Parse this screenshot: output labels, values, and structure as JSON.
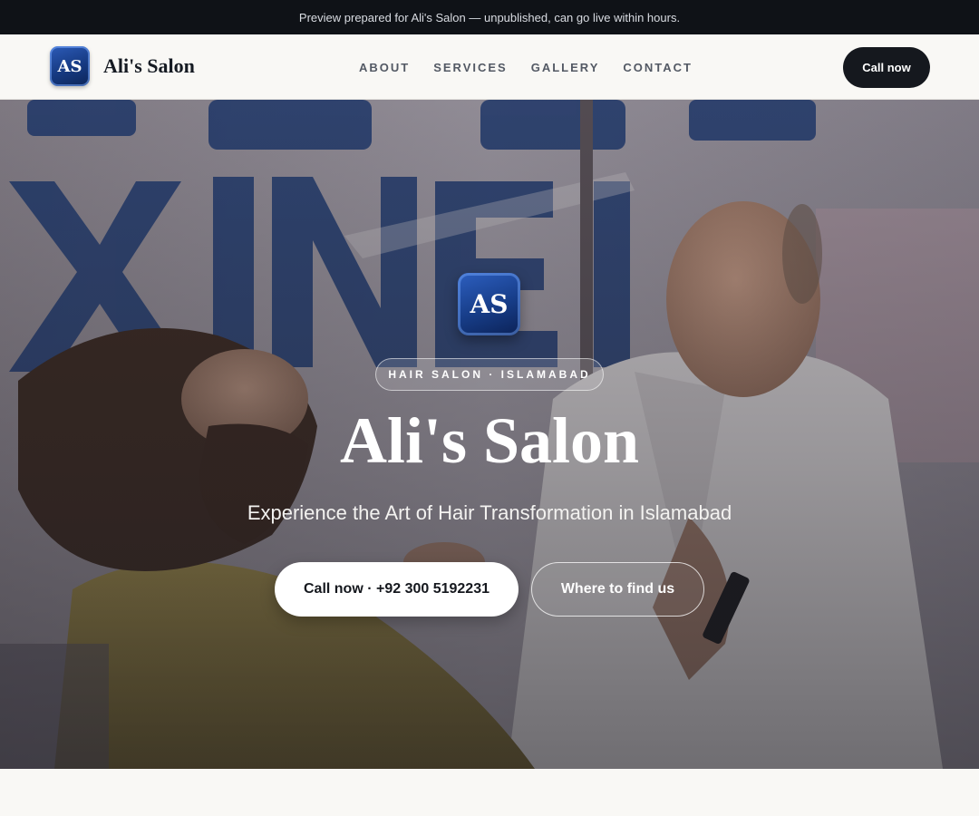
{
  "preview_banner": {
    "text": "Preview prepared for Ali's Salon — unpublished, can go live within hours."
  },
  "header": {
    "logo_initials": "AS",
    "brand_name": "Ali's Salon",
    "nav": [
      {
        "label": "ABOUT"
      },
      {
        "label": "SERVICES"
      },
      {
        "label": "GALLERY"
      },
      {
        "label": "CONTACT"
      }
    ],
    "cta_label": "Call now"
  },
  "hero": {
    "logo_initials": "AS",
    "tag": "HAIR SALON · ISLAMABAD",
    "title": "Ali's Salon",
    "subtitle": "Experience the Art of Hair Transformation in Islamabad",
    "primary_button": "Call now · +92 300 5192231",
    "secondary_button": "Where to find us"
  },
  "colors": {
    "dark": "#15181e",
    "brand_blue": "#163a82",
    "background": "#f9f8f5"
  }
}
